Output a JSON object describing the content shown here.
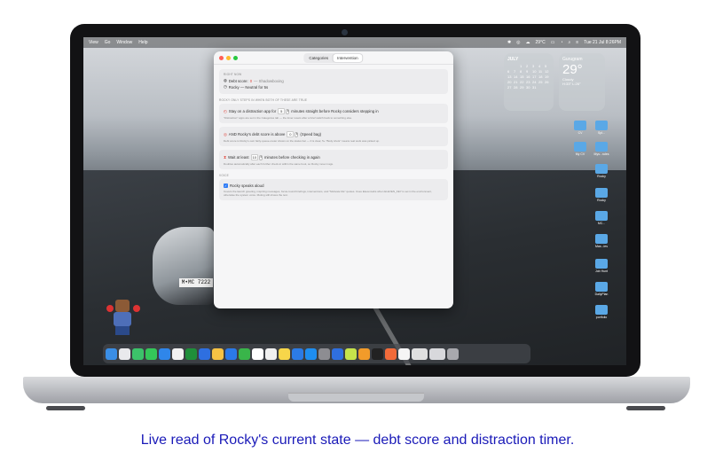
{
  "menubar": {
    "items": [
      "View",
      "Go",
      "Window",
      "Help"
    ],
    "weather": "29°C",
    "datetime": "Tue 21 Jul 8:26PM"
  },
  "widgets": {
    "calendar_month": "JULY",
    "calendar_days": [
      "",
      "",
      "1",
      "2",
      "3",
      "4",
      "5",
      "6",
      "7",
      "8",
      "9",
      "10",
      "11",
      "12",
      "13",
      "14",
      "15",
      "16",
      "17",
      "18",
      "19",
      "20",
      "21",
      "22",
      "23",
      "24",
      "25",
      "26",
      "27",
      "28",
      "29",
      "30",
      "31"
    ],
    "weather_city": "Gurugram",
    "weather_temp": "29°",
    "weather_cond": "Cloudy",
    "weather_range": "H:33° L:26°"
  },
  "desktop_icons": [
    "CV",
    "Spl...",
    "My CV",
    "Mys...rules",
    "Rocky",
    "Rocky",
    "MC...",
    "Mas...ies",
    "Job Hunt",
    "DailyPlan",
    "portfolio"
  ],
  "car_plate": "M•MC 7222",
  "window": {
    "tabs": [
      "Categories",
      "Intervention"
    ],
    "active_tab": "Intervention",
    "right_now": {
      "label": "RIGHT NOW",
      "debt_score_label": "Debt score:",
      "debt_score_value": "0",
      "debt_score_note": "— Shadowboxing",
      "rocky_state": "Rocky — Neutral for 5s"
    },
    "steps_label": "ROCKY ONLY STEPS IN WHEN BOTH OF THESE ARE TRUE",
    "condition1": {
      "prefix": "Stay on a distraction app for",
      "value": "5",
      "suffix": "minutes straight before Rocky considers stepping in",
      "hint": "\"Distraction\" apps are set in the Categories tab — the timer resets after a brief switch back to something else."
    },
    "condition2": {
      "prefix": "AND Rocky's debt score is above",
      "value": "0",
      "suffix": "(Speed bag)",
      "hint": "Debt score is Rocky's own fairly-queue-meter shown on the status bar — 0 is clear, 5+ \"Body shots\" means real work was picked up."
    },
    "wait": {
      "prefix": "Wait at least",
      "value": "10",
      "suffix": "minutes before checking in again",
      "hint": "Doubles automatically after each further check-in within the same bout, so Rocky never nags."
    },
    "voice_label": "VOICE",
    "voice": {
      "label": "Rocky speaks aloud",
      "hint": "Covers the launch greeting, inspiring messages, focus-round briefings, interventions, and \"Motivate Me\" quotes. Uses ElevenLabs when ELEVEN_KEY is set in the environment, otherwise the system voice. Muting still shows the text."
    }
  },
  "caption": "Live read of Rocky's current state — debt score and distraction timer."
}
